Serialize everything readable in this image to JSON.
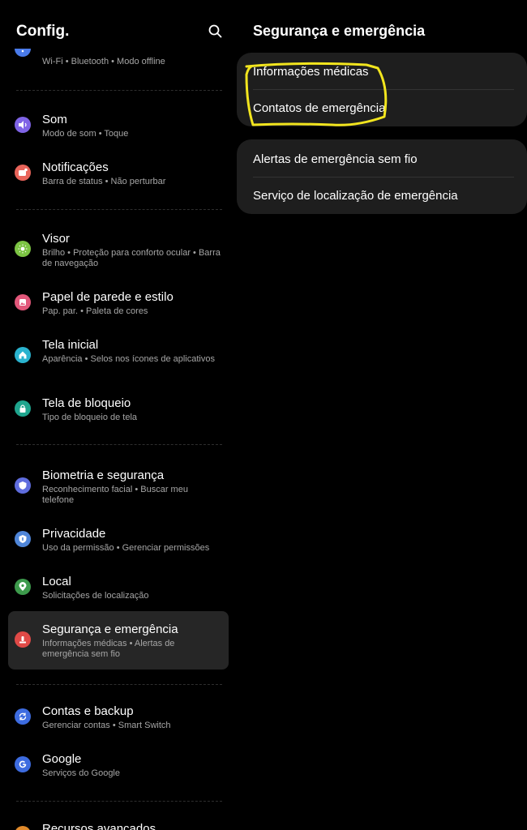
{
  "left_title": "Config.",
  "right_title": "Segurança e emergência",
  "settings_items": [
    {
      "title": "",
      "subtitle": "Wi-Fi • Bluetooth • Modo offline",
      "icon": "wifi-icon",
      "color": "#4a7bea"
    },
    {
      "title": "Som",
      "subtitle": "Modo de som • Toque",
      "icon": "volume-icon",
      "color": "#7f64e6"
    },
    {
      "title": "Notificações",
      "subtitle": "Barra de status • Não perturbar",
      "icon": "notification-icon",
      "color": "#e8645a"
    },
    {
      "title": "Visor",
      "subtitle": "Brilho • Proteção para conforto ocular • Barra de navegação",
      "icon": "brightness-icon",
      "color": "#7cc443"
    },
    {
      "title": "Papel de parede e estilo",
      "subtitle": "Pap. par. • Paleta de cores",
      "icon": "wallpaper-icon",
      "color": "#e2577a"
    },
    {
      "title": "Tela inicial",
      "subtitle": "Aparência • Selos nos ícones de aplicativos",
      "icon": "home-icon",
      "color": "#2ab3cf"
    },
    {
      "title": "Tela de bloqueio",
      "subtitle": "Tipo de bloqueio de tela",
      "icon": "lock-icon",
      "color": "#1fa58e"
    },
    {
      "title": "Biometria e segurança",
      "subtitle": "Reconhecimento facial • Buscar meu telefone",
      "icon": "shield-icon",
      "color": "#5f6dde"
    },
    {
      "title": "Privacidade",
      "subtitle": "Uso da permissão • Gerenciar permissões",
      "icon": "privacy-icon",
      "color": "#4f86d9"
    },
    {
      "title": "Local",
      "subtitle": "Solicitações de localização",
      "icon": "location-icon",
      "color": "#3d9a4c"
    },
    {
      "title": "Segurança e emergência",
      "subtitle": "Informações médicas • Alertas de emergência sem fio",
      "icon": "emergency-icon",
      "color": "#e04a47",
      "active": true
    },
    {
      "title": "Contas e backup",
      "subtitle": "Gerenciar contas • Smart Switch",
      "icon": "sync-icon",
      "color": "#3d6ce0"
    },
    {
      "title": "Google",
      "subtitle": "Serviços do Google",
      "icon": "google-icon",
      "color": "#3d6ce0"
    },
    {
      "title": "Recursos avançados",
      "subtitle": "",
      "icon": "star-icon",
      "color": "#e08a2b"
    }
  ],
  "detail_groups": [
    {
      "items": [
        "Informações médicas",
        "Contatos de emergência"
      ]
    },
    {
      "items": [
        "Alertas de emergência sem fio",
        "Serviço de localização de emergência"
      ]
    }
  ],
  "annotation_color": "#f2e51e"
}
